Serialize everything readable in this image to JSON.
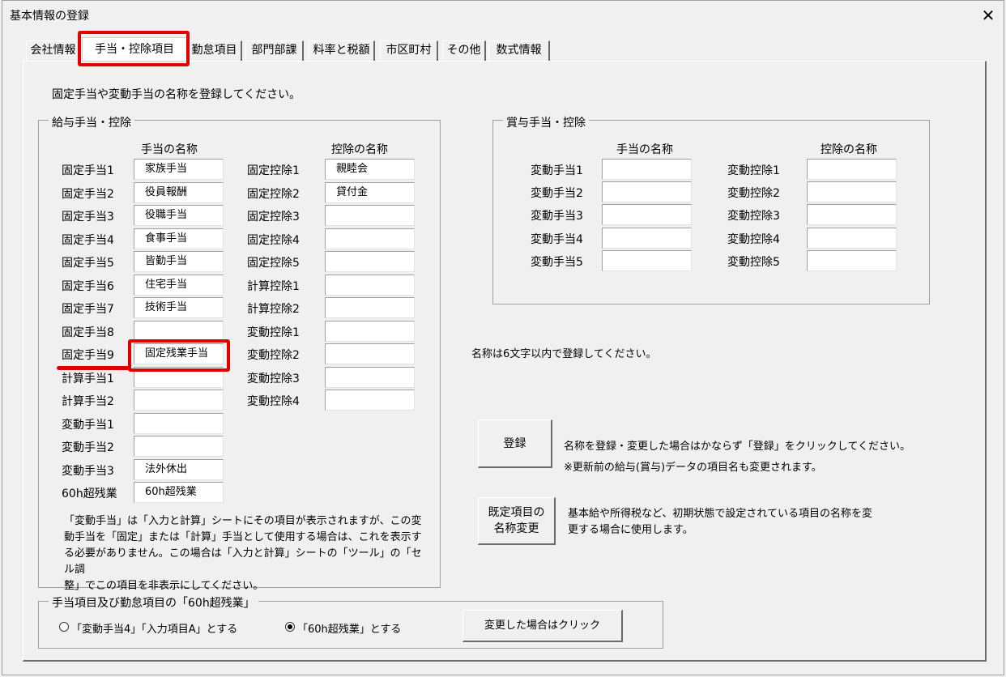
{
  "window": {
    "title": "基本情報の登録",
    "close_icon": "close-icon"
  },
  "tabs": [
    "会社情報",
    "手当・控除項目",
    "勤怠項目",
    "部門部課",
    "料率と税額",
    "市区町村",
    "その他",
    "数式情報"
  ],
  "intro": "固定手当や変動手当の名称を登録してください。",
  "kyuyo": {
    "legend": "給与手当・控除",
    "allowance_header": "手当の名称",
    "deduction_header": "控除の名称",
    "allowances": [
      {
        "label": "固定手当1",
        "value": "家族手当"
      },
      {
        "label": "固定手当2",
        "value": "役員報酬"
      },
      {
        "label": "固定手当3",
        "value": "役職手当"
      },
      {
        "label": "固定手当4",
        "value": "食事手当"
      },
      {
        "label": "固定手当5",
        "value": "皆勤手当"
      },
      {
        "label": "固定手当6",
        "value": "住宅手当"
      },
      {
        "label": "固定手当7",
        "value": "技術手当"
      },
      {
        "label": "固定手当8",
        "value": ""
      },
      {
        "label": "固定手当9",
        "value": "固定残業手当"
      },
      {
        "label": "計算手当1",
        "value": ""
      },
      {
        "label": "計算手当2",
        "value": ""
      },
      {
        "label": "変動手当1",
        "value": ""
      },
      {
        "label": "変動手当2",
        "value": ""
      },
      {
        "label": "変動手当3",
        "value": "法外休出"
      },
      {
        "label": "60h超残業",
        "value": "60h超残業"
      }
    ],
    "deductions": [
      {
        "label": "固定控除1",
        "value": "親睦会"
      },
      {
        "label": "固定控除2",
        "value": "貸付金"
      },
      {
        "label": "固定控除3",
        "value": ""
      },
      {
        "label": "固定控除4",
        "value": ""
      },
      {
        "label": "固定控除5",
        "value": ""
      },
      {
        "label": "計算控除1",
        "value": ""
      },
      {
        "label": "計算控除2",
        "value": ""
      },
      {
        "label": "変動控除1",
        "value": ""
      },
      {
        "label": "変動控除2",
        "value": ""
      },
      {
        "label": "変動控除3",
        "value": ""
      },
      {
        "label": "変動控除4",
        "value": ""
      }
    ],
    "note": [
      "「変動手当」は「入力と計算」シートにその項目が表示されますが、この変",
      "動手当を「固定」または「計算」手当として使用する場合は、これを表示す",
      "る必要がありません。この場合は「入力と計算」シートの「ツール」の「セル調",
      "整」でこの項目を非表示にしてください。"
    ]
  },
  "shoyo": {
    "legend": "賞与手当・控除",
    "allowance_header": "手当の名称",
    "deduction_header": "控除の名称",
    "allowances": [
      {
        "label": "変動手当1",
        "value": ""
      },
      {
        "label": "変動手当2",
        "value": ""
      },
      {
        "label": "変動手当3",
        "value": ""
      },
      {
        "label": "変動手当4",
        "value": ""
      },
      {
        "label": "変動手当5",
        "value": ""
      }
    ],
    "deductions": [
      {
        "label": "変動控除1",
        "value": ""
      },
      {
        "label": "変動控除2",
        "value": ""
      },
      {
        "label": "変動控除3",
        "value": ""
      },
      {
        "label": "変動控除4",
        "value": ""
      },
      {
        "label": "変動控除5",
        "value": ""
      }
    ]
  },
  "limit_note": "名称は6文字以内で登録してください。",
  "register": {
    "button": "登録",
    "note1": "名称を登録・変更した場合はかならず「登録」をクリックしてください。",
    "note2": "※更新前の給与(賞与)データの項目名も変更されます。"
  },
  "rename": {
    "button_line1": "既定項目の",
    "button_line2": "名称変更",
    "note1": "基本給や所得税など、初期状態で設定されている項目の名称を変",
    "note2": "更する場合に使用します。"
  },
  "overtime60": {
    "legend": "手当項目及び勤怠項目の「60h超残業」",
    "option1": "「変動手当4」「入力項目A」とする",
    "option2": "「60h超残業」とする",
    "selected": "option2",
    "button": "変更した場合はクリック"
  }
}
